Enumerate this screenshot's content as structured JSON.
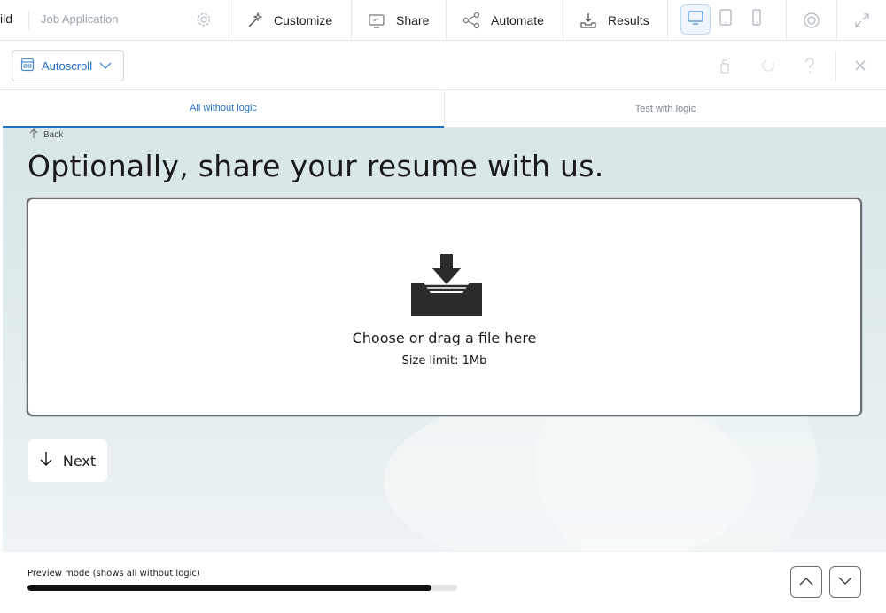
{
  "topbar": {
    "build_label": "ild",
    "form_name": "Job Application",
    "nav": [
      {
        "label": "Customize",
        "icon": "magic-wand-icon"
      },
      {
        "label": "Share",
        "icon": "share-screen-icon"
      },
      {
        "label": "Automate",
        "icon": "share-nodes-icon"
      },
      {
        "label": "Results",
        "icon": "inbox-tray-icon"
      }
    ],
    "devices": [
      "desktop-icon",
      "tablet-icon",
      "mobile-icon"
    ],
    "active_device": "desktop"
  },
  "toolbar": {
    "autoscroll_label": "Autoscroll"
  },
  "tabs": [
    {
      "label": "All without logic",
      "active": true
    },
    {
      "label": "Test with logic",
      "active": false
    }
  ],
  "form": {
    "back_label": "Back",
    "question": "Optionally, share your resume with us.",
    "dropzone_main": "Choose or drag a file here",
    "dropzone_sub": "Size limit: 1Mb",
    "next_label": "Next"
  },
  "footer": {
    "mode_label": "Preview mode (shows all without logic)",
    "progress_fraction": 0.94
  },
  "colors": {
    "accent": "#1f6fc5",
    "background": "#dde9ea"
  }
}
